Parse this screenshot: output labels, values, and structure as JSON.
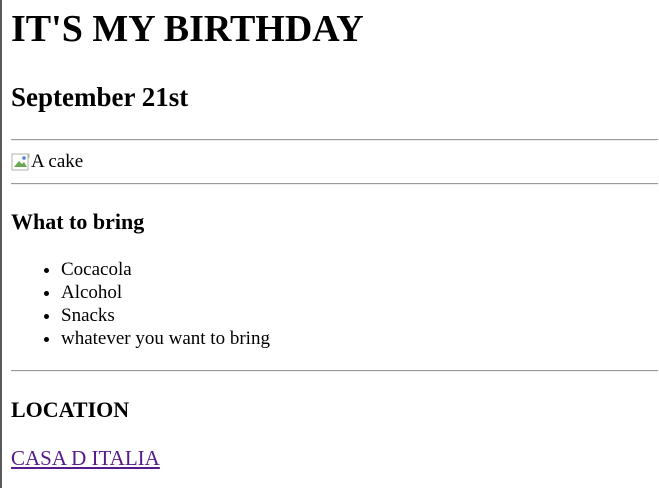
{
  "page": {
    "title": "IT'S MY BIRTHDAY",
    "date": "September 21st",
    "image": {
      "alt": "A cake",
      "icon": "broken-image-icon"
    },
    "bring": {
      "heading": "What to bring",
      "items": [
        {
          "label": "Cocacola"
        },
        {
          "label": "Alcohol"
        },
        {
          "label": "Snacks"
        },
        {
          "label": "whatever you want to bring"
        }
      ]
    },
    "location": {
      "heading": "LOCATION",
      "link_label": "CASA D ITALIA"
    }
  },
  "colors": {
    "text": "#000000",
    "visited_link": "#551a8b",
    "background": "#ffffff",
    "rule": "#9a9a9a"
  }
}
